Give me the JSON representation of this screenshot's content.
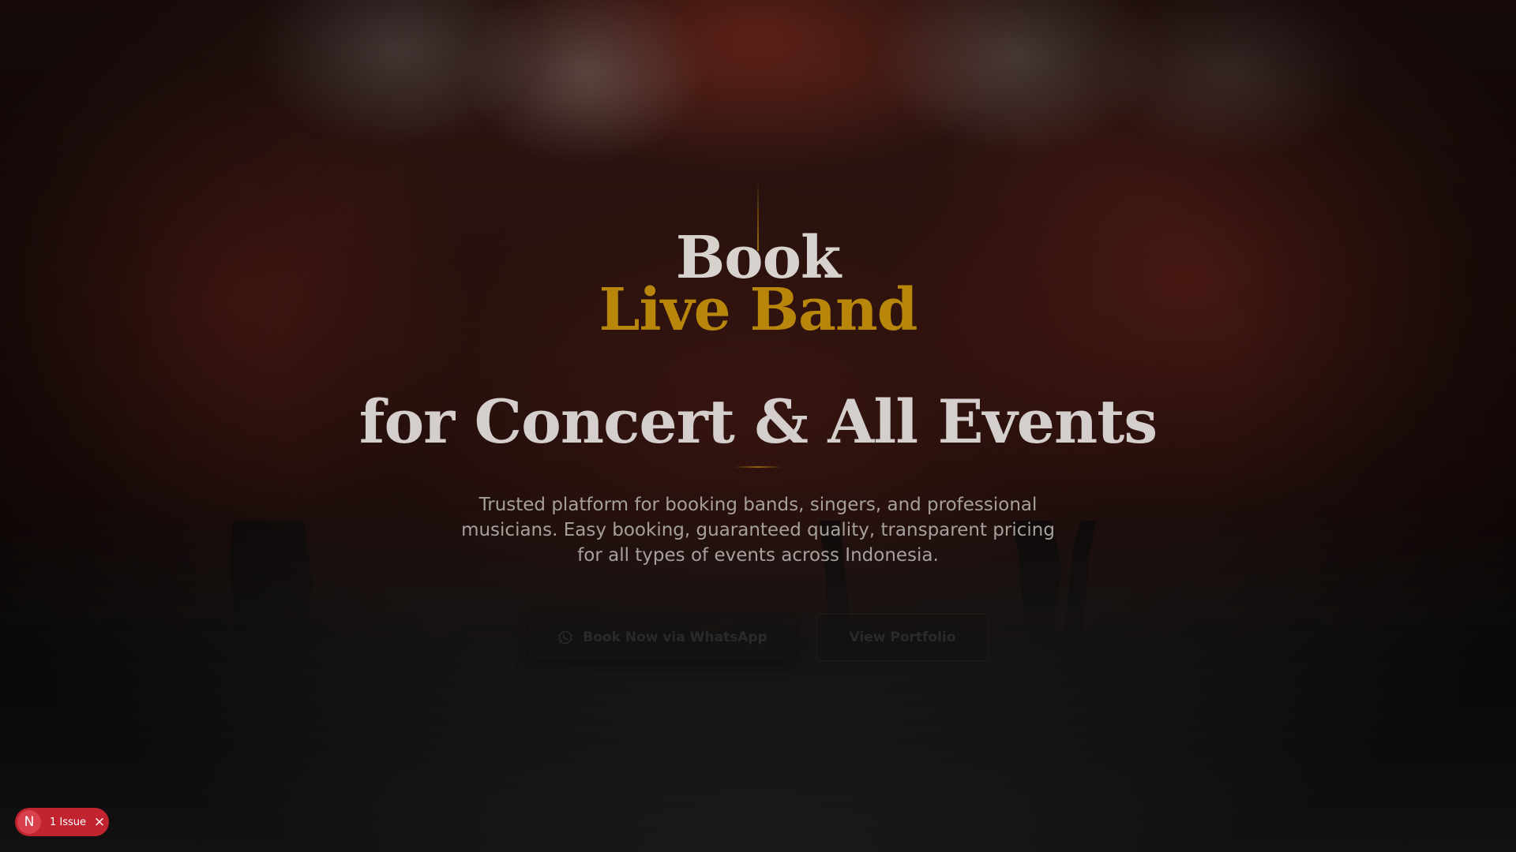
{
  "hero": {
    "headline_line1": "Book",
    "headline_line2": "Live Band",
    "headline_line3": "for Concert & All Events",
    "subtitle": "Trusted platform for booking bands, singers, and professional musicians. Easy booking, guaranteed quality, transparent pricing for all types of events across Indonesia.",
    "primary_button": {
      "label": "Book Now via WhatsApp",
      "icon": "whatsapp-icon"
    },
    "secondary_button": {
      "label": "View Portfolio"
    }
  },
  "dev_overlay": {
    "logo_letter": "N",
    "issue_label": "1 Issue",
    "close_glyph": "×"
  },
  "colors": {
    "accent_gold": "#b8860b",
    "headline_light": "#d8d2cf",
    "badge_red": "#c1242f"
  }
}
